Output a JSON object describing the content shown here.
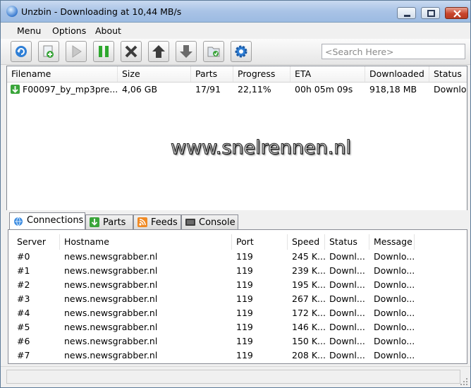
{
  "window": {
    "title": "Unzbin - Downloading at 10,44 MB/s"
  },
  "menu": [
    "Menu",
    "Options",
    "About"
  ],
  "toolbar": {
    "buttons": [
      "refresh-icon",
      "add-nzb-icon",
      "play-icon",
      "pause-icon",
      "delete-icon",
      "move-up-icon",
      "move-down-icon",
      "open-folder-icon",
      "settings-icon"
    ],
    "search_placeholder": "<Search Here>"
  },
  "downloads": {
    "columns": [
      "Filename",
      "Size",
      "Parts",
      "Progress",
      "ETA",
      "Downloaded",
      "Status"
    ],
    "rows": [
      {
        "filename": "F00097_by_mp3pre...",
        "size": "4,06 GB",
        "parts": "17/91",
        "progress": "22,11%",
        "eta": "00h 05m 09s",
        "downloaded": "918,18 MB",
        "status": "Downloa"
      }
    ]
  },
  "watermark": "www.snelrennen.nl",
  "tabs": [
    {
      "label": "Connections",
      "icon": "globe-icon"
    },
    {
      "label": "Parts",
      "icon": "download-arrow-icon"
    },
    {
      "label": "Feeds",
      "icon": "rss-icon"
    },
    {
      "label": "Console",
      "icon": "console-icon"
    }
  ],
  "connections": {
    "columns": [
      "Server",
      "Hostname",
      "Port",
      "Speed",
      "Status",
      "Message"
    ],
    "rows": [
      {
        "server": "#0",
        "hostname": "news.newsgrabber.nl",
        "port": "119",
        "speed": "245 K...",
        "status": "Downl...",
        "message": "Downlo..."
      },
      {
        "server": "#1",
        "hostname": "news.newsgrabber.nl",
        "port": "119",
        "speed": "239 K...",
        "status": "Downl...",
        "message": "Downlo..."
      },
      {
        "server": "#2",
        "hostname": "news.newsgrabber.nl",
        "port": "119",
        "speed": "195 K...",
        "status": "Downl...",
        "message": "Downlo..."
      },
      {
        "server": "#3",
        "hostname": "news.newsgrabber.nl",
        "port": "119",
        "speed": "267 K...",
        "status": "Downl...",
        "message": "Downlo..."
      },
      {
        "server": "#4",
        "hostname": "news.newsgrabber.nl",
        "port": "119",
        "speed": "172 K...",
        "status": "Downl...",
        "message": "Downlo..."
      },
      {
        "server": "#5",
        "hostname": "news.newsgrabber.nl",
        "port": "119",
        "speed": "146 K...",
        "status": "Downl...",
        "message": "Downlo..."
      },
      {
        "server": "#6",
        "hostname": "news.newsgrabber.nl",
        "port": "119",
        "speed": "150 K...",
        "status": "Downl...",
        "message": "Downlo..."
      },
      {
        "server": "#7",
        "hostname": "news.newsgrabber.nl",
        "port": "119",
        "speed": "208 K...",
        "status": "Downl...",
        "message": "Downlo..."
      }
    ]
  },
  "colors": {
    "titlebar": "#a9c3e6",
    "close_button": "#c8452d",
    "pause_green": "#2ea82e",
    "download_green": "#3aa53a"
  }
}
